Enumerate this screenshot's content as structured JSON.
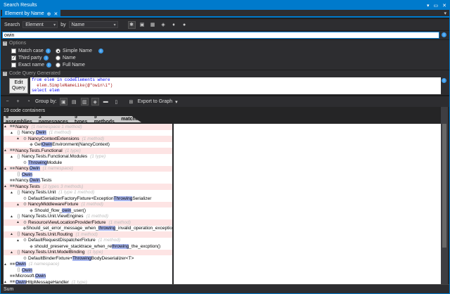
{
  "title": "Search Results",
  "tab": {
    "label": "Element by Name"
  },
  "search": {
    "search_label": "Search",
    "search_kind": "Element",
    "by_label": "by",
    "by_kind": "Name",
    "query_text": "owin"
  },
  "options": {
    "header": "Options",
    "match_case": "Match case",
    "third_party": "Third party",
    "exact_name": "Exact name",
    "simple_name": "Simple Name",
    "name": "Name",
    "full_name": "Full Name",
    "third_party_checked": true,
    "selected_radio": "Simple Name"
  },
  "code_query": {
    "header": "Code Query Generated",
    "edit_button_line1": "Edit",
    "edit_button_line2": "Query",
    "line1_kw": "from elem in codeElements where",
    "line2": "  elem.SimpleNameLike(@\"owin\\i\")",
    "line3": "select elem"
  },
  "groupbar": {
    "group_by_label": "Group by:",
    "export_label": "Export to Graph"
  },
  "results": {
    "count_text": "19 code containers",
    "summary": [
      "6 assemblies",
      "3 namespaces",
      "5 types",
      "5 methods",
      "matched"
    ]
  },
  "tree": [
    {
      "indent": 0,
      "exp": "▲",
      "icon": "■■",
      "text": "Nancy",
      "meta": "(1 namespace   1 method)",
      "pink": true
    },
    {
      "indent": 1,
      "exp": "▲",
      "icon": "{}",
      "text": "Nancy.Owin",
      "meta": "(1 method)",
      "pink": false
    },
    {
      "indent": 2,
      "exp": "▲",
      "icon": "⚙",
      "text": "NancyContextExtensions",
      "meta": "(1 method)",
      "pink": true
    },
    {
      "indent": 3,
      "exp": "",
      "icon": "◆",
      "text": "GetOwinEnvironment(NancyContext)",
      "meta": "",
      "pink": false
    },
    {
      "indent": 0,
      "exp": "▲",
      "icon": "■■",
      "text": "Nancy.Tests.Functional",
      "meta": "(1 type)",
      "pink": true
    },
    {
      "indent": 1,
      "exp": "▲",
      "icon": "{}",
      "text": "Nancy.Tests.Functional.Modules",
      "meta": "(1 type)",
      "pink": false
    },
    {
      "indent": 2,
      "exp": "",
      "icon": "⚙",
      "text": "ThrowingModule",
      "meta": "",
      "pink": false
    },
    {
      "indent": 0,
      "exp": "▲",
      "icon": "■■",
      "text": "Nancy.Owin",
      "meta": "(1 namespace)",
      "pink": true
    },
    {
      "indent": 1,
      "exp": "",
      "icon": "{}",
      "text": "Owin",
      "meta": "",
      "pink": false
    },
    {
      "indent": 0,
      "exp": "",
      "icon": "■■",
      "text": "Nancy.Owin.Tests",
      "meta": "",
      "pink": false
    },
    {
      "indent": 0,
      "exp": "▲",
      "icon": "■■",
      "text": "Nancy.Tests",
      "meta": "(2 types   3 methods)",
      "pink": true
    },
    {
      "indent": 1,
      "exp": "▲",
      "icon": "{}",
      "text": "Nancy.Tests.Unit",
      "meta": "(1 type   1 method)",
      "pink": false
    },
    {
      "indent": 2,
      "exp": "",
      "icon": "⚙",
      "text": "DefaultSerializerFactoryFixture+ExceptionThrowingSerializer",
      "meta": "",
      "pink": false
    },
    {
      "indent": 2,
      "exp": "▲",
      "icon": "⚙",
      "text": "NancyMiddlewareFixture",
      "meta": "(1 method)",
      "pink": true
    },
    {
      "indent": 3,
      "exp": "",
      "icon": "◆",
      "text": "Should_flow_owin_user()",
      "meta": "",
      "pink": false
    },
    {
      "indent": 1,
      "exp": "▲",
      "icon": "{}",
      "text": "Nancy.Tests.Unit.ViewEngines",
      "meta": "(1 method)",
      "pink": false
    },
    {
      "indent": 2,
      "exp": "▲",
      "icon": "⚙",
      "text": "ResourceViewLocationProviderFixture",
      "meta": "(1 method)",
      "pink": true
    },
    {
      "indent": 3,
      "exp": "",
      "icon": "◆",
      "text": "Should_set_error_message_when_throwing_invalid_operation_exceptio",
      "meta": "",
      "pink": false
    },
    {
      "indent": 1,
      "exp": "▲",
      "icon": "{}",
      "text": "Nancy.Tests.Unit.Routing",
      "meta": "(1 method)",
      "pink": true
    },
    {
      "indent": 2,
      "exp": "▲",
      "icon": "⚙",
      "text": "DefaultRequestDispatcherFixture",
      "meta": "(1 method)",
      "pink": false
    },
    {
      "indent": 3,
      "exp": "",
      "icon": "◆",
      "text": "should_preserve_stacktrace_when_rethrowing_the_excption()",
      "meta": "",
      "pink": false
    },
    {
      "indent": 1,
      "exp": "▲",
      "icon": "{}",
      "text": "Nancy.Tests.Unit.ModelBinding",
      "meta": "(1 type)",
      "pink": true
    },
    {
      "indent": 2,
      "exp": "",
      "icon": "⚙",
      "text": "DefaultBinderFixture+ThrowingBodyDeserializer<T>",
      "meta": "",
      "pink": false
    },
    {
      "indent": 0,
      "exp": "▲",
      "icon": "■■",
      "text": "Owin",
      "meta": "(1 namespace)",
      "pink": false
    },
    {
      "indent": 1,
      "exp": "",
      "icon": "{}",
      "text": "Owin",
      "meta": "",
      "pink": false
    },
    {
      "indent": 0,
      "exp": "",
      "icon": "■■",
      "text": "Microsoft.Owin",
      "meta": "",
      "pink": false
    },
    {
      "indent": 0,
      "exp": "▲",
      "icon": "■■",
      "text": "OwinHttpMessageHandler",
      "meta": "(1 type)",
      "pink": false
    }
  ],
  "status": {
    "text": "Sum"
  }
}
